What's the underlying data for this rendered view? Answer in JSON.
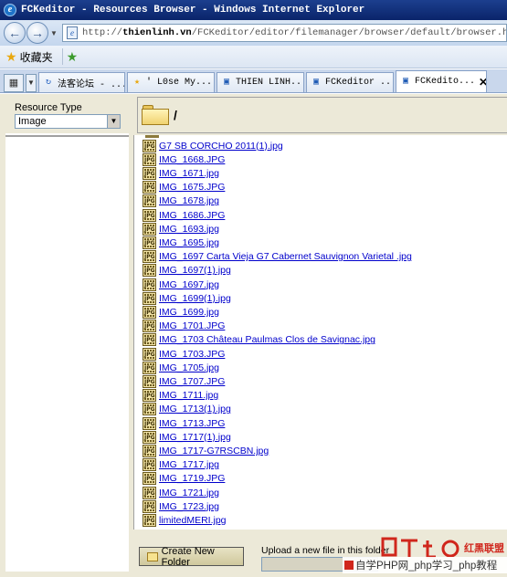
{
  "window": {
    "title": "FCKeditor - Resources Browser - Windows Internet Explorer"
  },
  "address": {
    "host": "thienlinh.vn",
    "prefix": "http://",
    "path": "/FCKeditor/editor/filemanager/browser/default/browser.html?Type=Ima"
  },
  "favorites": {
    "label": "收藏夹"
  },
  "tabs": [
    {
      "label": "法客论坛 - ...",
      "icon": "loading-icon",
      "active": false
    },
    {
      "label": "' L0se My...",
      "icon": "star-icon",
      "active": false
    },
    {
      "label": "THIEN LINH...",
      "icon": "ie-page-icon",
      "active": false
    },
    {
      "label": "FCKeditor ...",
      "icon": "ie-page-icon",
      "active": false
    },
    {
      "label": "FCKedito...",
      "icon": "ie-page-icon",
      "active": true
    }
  ],
  "resource_type": {
    "label": "Resource Type",
    "selected": "Image"
  },
  "current_path": "/",
  "files": [
    "G7 SB CORCHO 2011(1).jpg",
    "IMG_1668.JPG",
    "IMG_1671.jpg",
    "IMG_1675.JPG",
    "IMG_1678.jpg",
    "IMG_1686.JPG",
    "IMG_1693.jpg",
    "IMG_1695.jpg",
    "IMG_1697 Carta Vieja G7 Cabernet Sauvignon Varietal .jpg",
    "IMG_1697(1).jpg",
    "IMG_1697.jpg",
    "IMG_1699(1).jpg",
    "IMG_1699.jpg",
    "IMG_1701.JPG",
    "IMG_1703 Château Paulmas Clos de Savignac.jpg",
    "IMG_1703.JPG",
    "IMG_1705.jpg",
    "IMG_1707.JPG",
    "IMG_1711.jpg",
    "IMG_1713(1).jpg",
    "IMG_1713.JPG",
    "IMG_1717(1).jpg",
    "IMG_1717-G7RSCBN.jpg",
    "IMG_1717.jpg",
    "IMG_1719.JPG",
    "IMG_1721.jpg",
    "IMG_1723.jpg",
    "limitedMERI.jpg"
  ],
  "file_icon_text": "JPG",
  "buttons": {
    "create_folder": "Create New Folder"
  },
  "upload": {
    "label": "Upload a new file in this folder"
  },
  "watermark": {
    "brand": "红黑联盟",
    "bar": "自学PHP网_php学习_php教程"
  }
}
